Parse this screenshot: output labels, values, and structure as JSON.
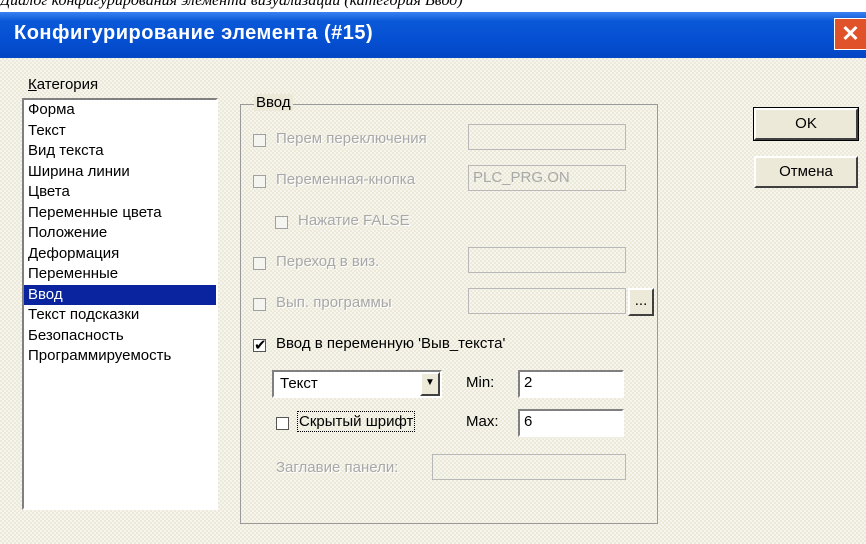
{
  "caption": "Диалог конфигурирования элемента визуализации (категория Ввод)",
  "window": {
    "title": "Конфигурирование элемента (#15)",
    "close_glyph": "✕"
  },
  "category": {
    "label_u": "К",
    "label_rest": "атегория",
    "items": [
      "Форма",
      "Текст",
      "Вид текста",
      "Ширина линии",
      "Цвета",
      "Переменные цвета",
      "Положение",
      "Деформация",
      "Переменные",
      "Ввод",
      "Текст подсказки",
      "Безопасность",
      "Программируемость"
    ],
    "selected": "Ввод"
  },
  "input_group": {
    "title": "Ввод",
    "toggle_var": {
      "label": "Перем переключения",
      "checked": false,
      "value": ""
    },
    "var_button": {
      "label": "Переменная-кнопка",
      "checked": false,
      "value": "PLC_PRG.ON"
    },
    "press_false": {
      "label": "Нажатие FALSE",
      "checked": false
    },
    "goto_vis": {
      "label": "Переход в виз.",
      "checked": false,
      "value": ""
    },
    "run_program": {
      "label": "Вып. программы",
      "checked": false,
      "value": "",
      "browse_label": "..."
    },
    "text_input": {
      "label": "Ввод в переменную 'Выв_текста'",
      "checked": true,
      "check_glyph": "✔"
    },
    "type_select": {
      "value": "Текст",
      "arrow": "▼"
    },
    "min": {
      "label": "Min:",
      "value": "2"
    },
    "max": {
      "label": "Max:",
      "value": "6"
    },
    "hidden_font": {
      "label": "Скрытый шрифт",
      "checked": false
    },
    "panel_title": {
      "label": "Заглавие панели:",
      "value": ""
    }
  },
  "buttons": {
    "ok": "OK",
    "cancel": "Отмена"
  },
  "colors": {
    "titlebar": "#0550d2",
    "selection": "#0a24a0",
    "close": "#e0522a"
  }
}
